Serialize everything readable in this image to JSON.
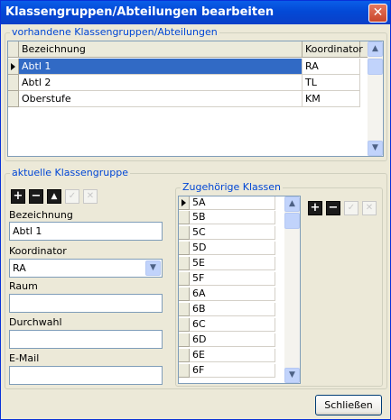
{
  "window": {
    "title": "Klassengruppen/Abteilungen bearbeiten",
    "close_glyph": "✕"
  },
  "groups_section": {
    "legend": "vorhandene Klassengruppen/Abteilungen",
    "columns": [
      "Bezeichnung",
      "Koordinator"
    ],
    "rows": [
      {
        "bezeichnung": "Abtl 1",
        "koordinator": "RA",
        "selected": true
      },
      {
        "bezeichnung": "Abtl 2",
        "koordinator": "TL",
        "selected": false
      },
      {
        "bezeichnung": "Oberstufe",
        "koordinator": "KM",
        "selected": false
      }
    ]
  },
  "current_section": {
    "legend": "aktuelle Klassengruppe",
    "toolbar": [
      {
        "name": "add-icon",
        "glyph": "+"
      },
      {
        "name": "remove-icon",
        "glyph": "−"
      },
      {
        "name": "move-up-icon",
        "glyph": "▲"
      },
      {
        "name": "confirm-icon",
        "glyph": "✓"
      },
      {
        "name": "cancel-icon",
        "glyph": "✕"
      }
    ],
    "bezeichnung_label": "Bezeichnung",
    "bezeichnung_value": "Abtl 1",
    "koordinator_label": "Koordinator",
    "koordinator_value": "RA",
    "raum_label": "Raum",
    "raum_value": "",
    "durchwahl_label": "Durchwahl",
    "durchwahl_value": "",
    "email_label": "E-Mail",
    "email_value": ""
  },
  "classes_section": {
    "legend": "Zugehörige Klassen",
    "classes": [
      "5A",
      "5B",
      "5C",
      "5D",
      "5E",
      "5F",
      "6A",
      "6B",
      "6C",
      "6D",
      "6E",
      "6F"
    ],
    "toolbar": [
      {
        "name": "add-class-icon",
        "glyph": "+"
      },
      {
        "name": "remove-class-icon",
        "glyph": "−"
      },
      {
        "name": "confirm-class-icon",
        "glyph": "✓"
      },
      {
        "name": "cancel-class-icon",
        "glyph": "✕"
      }
    ]
  },
  "footer": {
    "close_label": "Schließen"
  }
}
